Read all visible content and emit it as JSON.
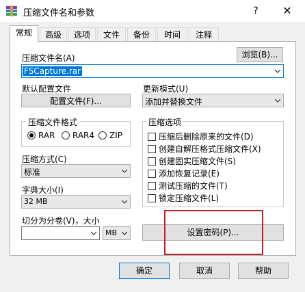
{
  "window": {
    "title": "压缩文件名和参数",
    "help_symbol": "?",
    "close_symbol": "✕"
  },
  "tabs": [
    {
      "label": "常规",
      "active": true
    },
    {
      "label": "高级"
    },
    {
      "label": "选项"
    },
    {
      "label": "文件"
    },
    {
      "label": "备份"
    },
    {
      "label": "时间"
    },
    {
      "label": "注释"
    }
  ],
  "archive": {
    "label": "压缩文件名(A)",
    "value": "FSCapture.rar",
    "browse_label": "浏览(B)..."
  },
  "profile": {
    "label": "默认配置文件",
    "button_label": "配置文件(F)..."
  },
  "update_mode": {
    "label": "更新模式(U)",
    "value": "添加并替换文件"
  },
  "format": {
    "label": "压缩文件格式",
    "options": [
      "RAR",
      "RAR4",
      "ZIP"
    ],
    "selected": "RAR"
  },
  "method": {
    "label": "压缩方式(C)",
    "value": "标准"
  },
  "dictionary": {
    "label": "字典大小(I)",
    "value": "32 MB"
  },
  "split": {
    "label": "切分为分卷(V)，大小",
    "value": "",
    "unit": "MB"
  },
  "archive_options": {
    "label": "压缩选项",
    "items": [
      {
        "label": "压缩后删除原来的文件(D)",
        "checked": false
      },
      {
        "label": "创建自解压格式压缩文件(X)",
        "checked": false
      },
      {
        "label": "创建固实压缩文件(S)",
        "checked": false
      },
      {
        "label": "添加恢复记录(E)",
        "checked": false
      },
      {
        "label": "测试压缩的文件(T)",
        "checked": false
      },
      {
        "label": "锁定压缩文件(L)",
        "checked": false
      }
    ]
  },
  "password_button_label": "设置密码(P)...",
  "footer": {
    "ok": "确定",
    "cancel": "取消",
    "help": "帮助"
  },
  "colors": {
    "accent": "#0078d7",
    "highlight": "#c0202a"
  }
}
